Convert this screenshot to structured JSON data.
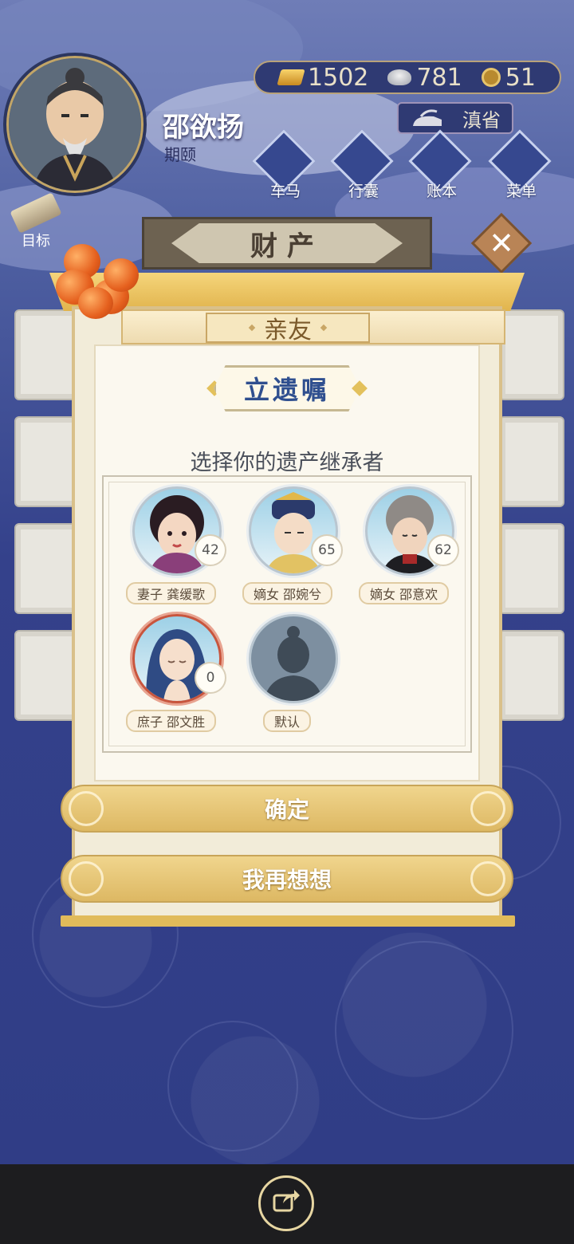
{
  "player": {
    "name": "邵欲扬",
    "subtitle": "期颐"
  },
  "resources": {
    "gold": "1502",
    "silver": "781",
    "coins": "51"
  },
  "province": "滇省",
  "nav": [
    {
      "label": "车马",
      "icon": "carriage-icon"
    },
    {
      "label": "行囊",
      "icon": "bag-icon"
    },
    {
      "label": "账本",
      "icon": "ledger-icon"
    },
    {
      "label": "菜单",
      "icon": "menu-dots-icon"
    }
  ],
  "goal_label": "目标",
  "section_title": "财产",
  "tab_label": "亲友",
  "modal": {
    "title": "立遗嘱",
    "subtitle": "选择你的遗产继承者",
    "heirs": [
      {
        "label": "妻子 龚缓歌",
        "age": "42"
      },
      {
        "label": "嫡女 邵婉兮",
        "age": "65"
      },
      {
        "label": "嫡女 邵意欢",
        "age": "62"
      },
      {
        "label": "庶子 邵文胜",
        "age": "0"
      },
      {
        "label": "默认",
        "age": ""
      }
    ],
    "confirm_label": "确定",
    "cancel_label": "我再想想"
  },
  "colors": {
    "accent_gold": "#ddb863",
    "title_blue": "#2f4f8f",
    "background_blue": "#34418b"
  }
}
